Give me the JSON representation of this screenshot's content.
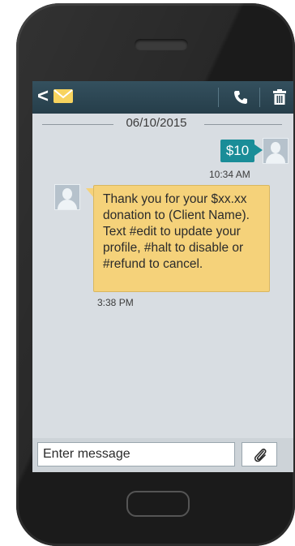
{
  "header": {
    "back_glyph": "<",
    "icons": [
      "chevron-left-icon",
      "envelope-icon",
      "phone-icon",
      "trash-icon"
    ]
  },
  "conversation": {
    "date": "06/10/2015",
    "sent_message": {
      "text": "$10",
      "time": "10:34 AM"
    },
    "received_message": {
      "text": "Thank you for your $xx.xx donation to (Client Name). Text #edit to update your profile, #halt to disable or #refund to cancel.",
      "time": "3:38 PM"
    }
  },
  "composer": {
    "placeholder": "Enter message",
    "attach_icon": "paperclip-icon"
  },
  "colors": {
    "header_bg": "#2f4956",
    "screen_bg": "#d8dde2",
    "sent_bubble": "#1a8d98",
    "received_bubble": "#f5d27a",
    "envelope": "#f7d35e",
    "phone_body": "#1b1b1b"
  }
}
